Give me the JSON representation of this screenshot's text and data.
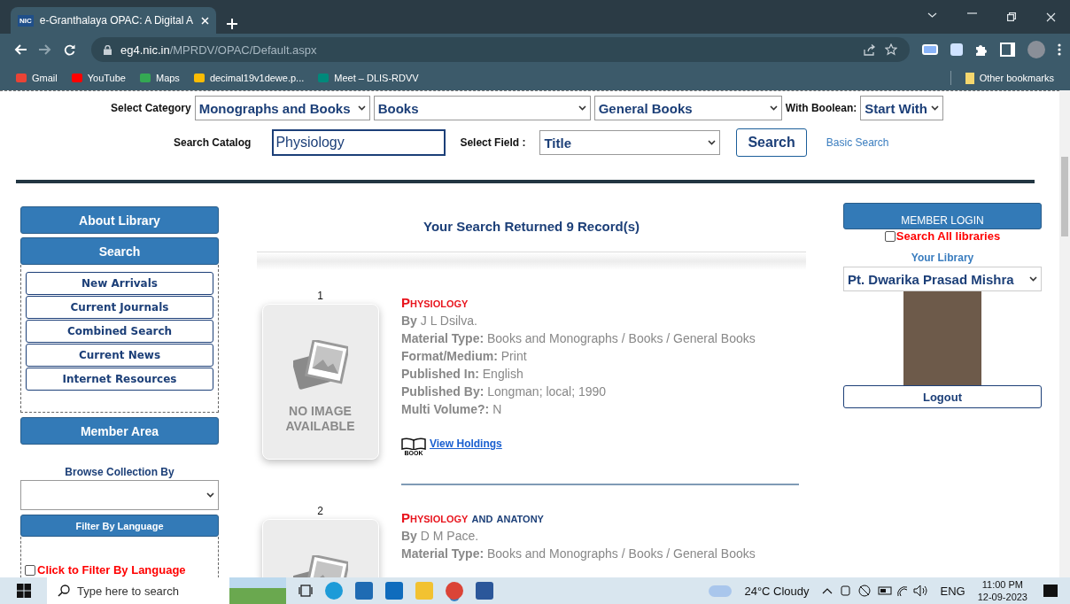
{
  "browser": {
    "tab": {
      "title": "e-Granthalaya OPAC: A Digital A",
      "favicon": "NIC"
    },
    "url_host": "eg4.nic.in",
    "url_path": "/MPRDV/OPAC/Default.aspx",
    "bookmarks": [
      {
        "label": "Gmail",
        "kind": "gmail"
      },
      {
        "label": "YouTube",
        "kind": "youtube"
      },
      {
        "label": "Maps",
        "kind": "maps"
      },
      {
        "label": "decimal19v1dewe.p...",
        "kind": "drive"
      },
      {
        "label": "Meet – DLIS-RDVV",
        "kind": "meet"
      }
    ],
    "other_bookmarks": "Other bookmarks"
  },
  "search_form": {
    "category_label": "Select Category",
    "category": "Monographs and Books",
    "subcategory": "Books",
    "type": "General Books",
    "boolean_label": "With Boolean:",
    "boolean": "Start With",
    "catalog_label": "Search Catalog",
    "query": "Physiology",
    "field_label": "Select Field :",
    "field": "Title",
    "search_button": "Search",
    "basic_search": "Basic Search"
  },
  "sidebar": {
    "about": "About Library",
    "search": "Search",
    "links": [
      "New Arrivals",
      "Current Journals",
      "Combined Search",
      "Current News",
      "Internet Resources"
    ],
    "member_area": "Member Area",
    "browse_label": "Browse Collection By",
    "filter_button": "Filter By Language",
    "filter_checkbox": {
      "label": "Click to Filter By Language",
      "checked": false
    }
  },
  "results": {
    "heading": "Your Search Returned 9 Record(s)",
    "no_image": "NO IMAGE AVAILABLE",
    "records": [
      {
        "number": "1",
        "title_match": "Physiology",
        "fields": [
          {
            "label": "By",
            "value": "J L Dsilva."
          },
          {
            "label": "Material Type:",
            "value": "Books and Monographs / Books / General Books"
          },
          {
            "label": "Format/Medium:",
            "value": "Print"
          },
          {
            "label": "Published In:",
            "value": "English"
          },
          {
            "label": "Published By:",
            "value": "Longman; local; 1990"
          },
          {
            "label": "Multi Volume?:",
            "value": "N"
          }
        ],
        "holdings": "View Holdings",
        "book_caption": "BOOK"
      },
      {
        "number": "2",
        "title_match": "Physiology",
        "title_rest": " and anatony",
        "fields": [
          {
            "label": "By",
            "value": "D M Pace."
          },
          {
            "label": "Material Type:",
            "value": "Books and Monographs / Books / General Books"
          }
        ]
      }
    ]
  },
  "member": {
    "login": "MEMBER LOGIN",
    "search_all": {
      "label": "Search All libraries",
      "checked": false
    },
    "your_library": "Your Library",
    "library": "Pt. Dwarika Prasad Mishra",
    "logout": "Logout"
  },
  "taskbar": {
    "search_placeholder": "Type here to search",
    "weather": "24°C  Cloudy",
    "language": "ENG",
    "time": "11:00 PM",
    "date": "12-09-2023"
  }
}
